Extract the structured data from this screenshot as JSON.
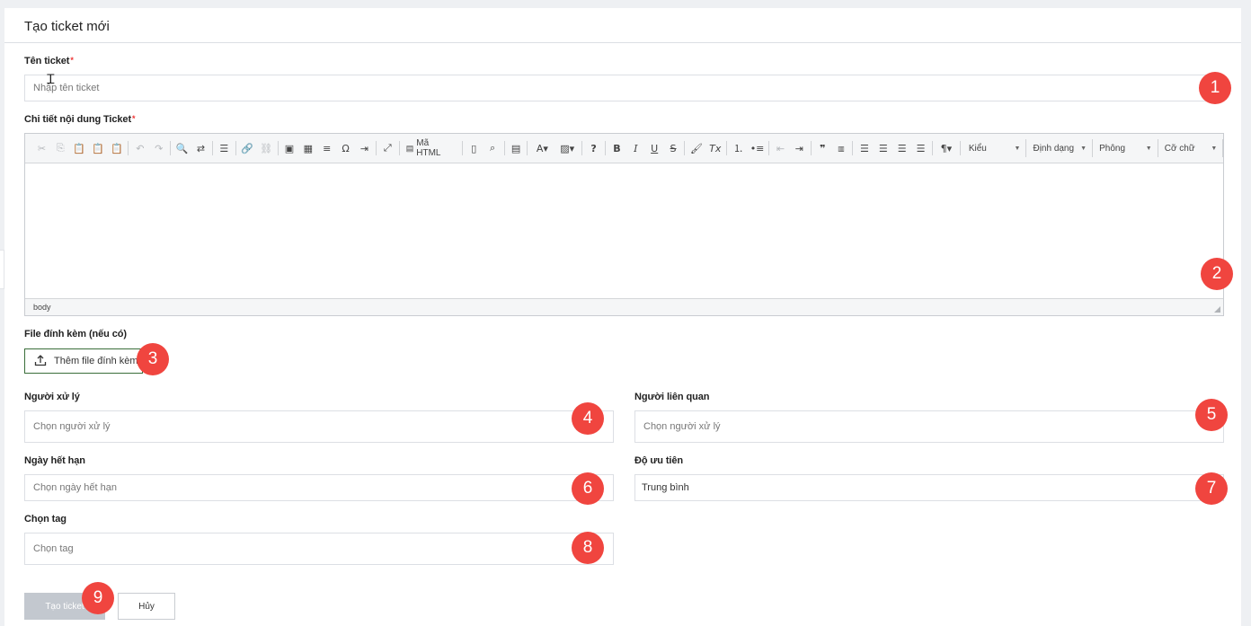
{
  "form": {
    "title": "Tạo ticket mới",
    "ticket_name": {
      "label": "Tên ticket",
      "required_mark": "*",
      "placeholder": "Nhập tên ticket"
    },
    "content": {
      "label": "Chi tiết nội dung Ticket",
      "required_mark": "*",
      "status_path": "body"
    },
    "attachment": {
      "label": "File đính kèm (nếu có)",
      "button": "Thêm file đính kèm"
    },
    "assignee": {
      "label": "Người xử lý",
      "placeholder": "Chọn người xử lý"
    },
    "related": {
      "label": "Người liên quan",
      "placeholder": "Chọn người xử lý"
    },
    "due_date": {
      "label": "Ngày hết hạn",
      "placeholder": "Chọn ngày hết hạn"
    },
    "priority": {
      "label": "Độ ưu tiên",
      "value": "Trung bình"
    },
    "tag": {
      "label": "Chọn tag",
      "placeholder": "Chọn tag"
    },
    "actions": {
      "submit": "Tạo ticket",
      "cancel": "Hủy"
    }
  },
  "toolbar": {
    "source_label": "Mã HTML",
    "styles": "Kiểu",
    "format": "Định dạng",
    "font": "Phông",
    "size": "Cỡ chữ"
  },
  "badges": [
    "1",
    "2",
    "3",
    "4",
    "5",
    "6",
    "7",
    "8",
    "9"
  ],
  "colors": {
    "badge": "#f0453f",
    "submit_disabled": "#c3c8cf",
    "attach_border": "#3a6e3a",
    "required": "#e33333"
  }
}
